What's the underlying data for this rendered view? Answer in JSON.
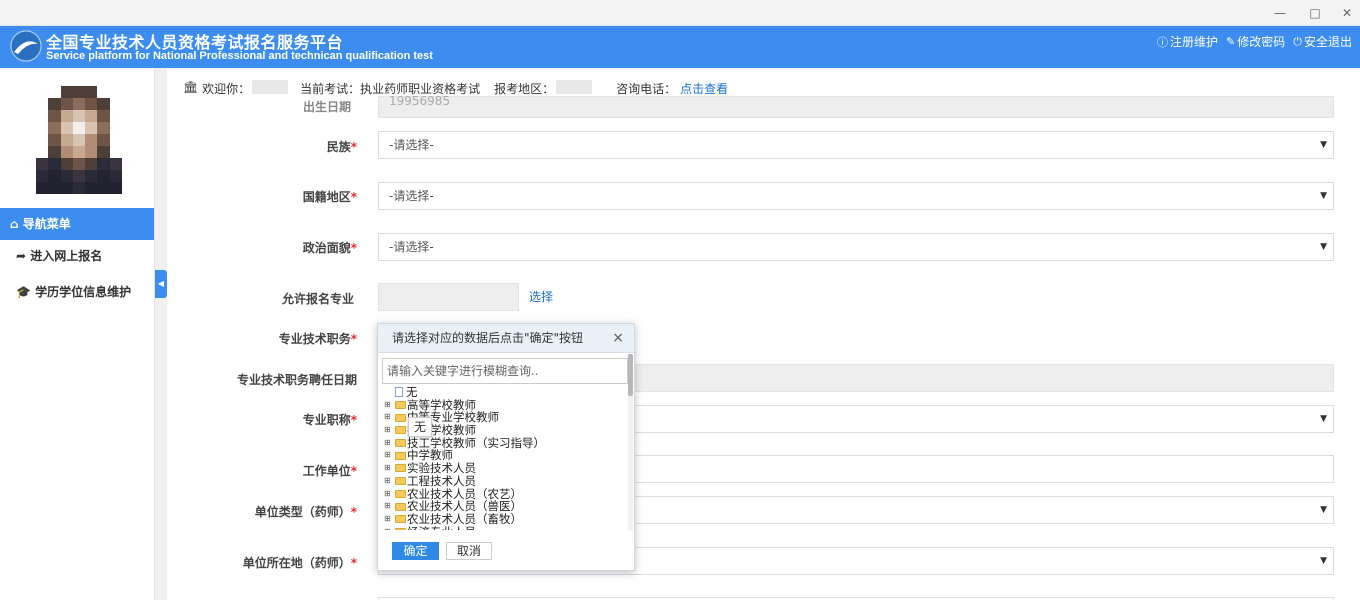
{
  "window": {
    "minimize": "—",
    "maximize": "□",
    "close": "✕"
  },
  "header": {
    "title_cn": "全国专业技术人员资格考试报名服务平台",
    "title_en": "Service platform for National Professional and technican qualification test",
    "actions": {
      "register_maintain": "注册维护",
      "change_password": "修改密码",
      "logout": "安全退出"
    }
  },
  "sidebar": {
    "nav_title": "导航菜单",
    "items": [
      {
        "label": "进入网上报名"
      },
      {
        "label": "学历学位信息维护"
      }
    ]
  },
  "info_bar": {
    "welcome": "欢迎你：",
    "current_exam_label": "当前考试：",
    "current_exam": "执业药师职业资格考试",
    "region_label": "报考地区：",
    "phone_label": "咨询电话：",
    "phone_link": "点击查看"
  },
  "form": {
    "partial_top_label": "出生日期",
    "partial_top_value": "19956985",
    "ethnicity": {
      "label": "民族",
      "value": "-请选择-"
    },
    "nationality": {
      "label": "国籍地区",
      "value": "-请选择-"
    },
    "political": {
      "label": "政治面貌",
      "value": "-请选择-"
    },
    "allowed_major": {
      "label": "允许报名专业",
      "link": "选择"
    },
    "tech_position": {
      "label": "专业技术职务"
    },
    "tech_position_date": {
      "label": "专业技术职务聘任日期"
    },
    "tech_title": {
      "label": "专业职称"
    },
    "work_unit": {
      "label": "工作单位"
    },
    "unit_type": {
      "label": "单位类型（药师）"
    },
    "unit_location": {
      "label": "单位所在地（药师）"
    },
    "required_mark": "*"
  },
  "modal": {
    "title": "请选择对应的数据后点击\"确定\"按钮",
    "close": "×",
    "search_placeholder": "请输入关键字进行模糊查询..",
    "tree": [
      {
        "label": "无",
        "type": "file"
      },
      {
        "label": "高等学校教师",
        "type": "folder"
      },
      {
        "label": "中等专业学校教师",
        "type": "folder"
      },
      {
        "label": "技工学校教师",
        "type": "folder"
      },
      {
        "label": "技工学校教师（实习指导）",
        "type": "folder"
      },
      {
        "label": "中学教师",
        "type": "folder"
      },
      {
        "label": "实验技术人员",
        "type": "folder"
      },
      {
        "label": "工程技术人员",
        "type": "folder"
      },
      {
        "label": "农业技术人员（农艺）",
        "type": "folder"
      },
      {
        "label": "农业技术人员（兽医）",
        "type": "folder"
      },
      {
        "label": "农业技术人员（畜牧）",
        "type": "folder"
      },
      {
        "label": "经济专业人员",
        "type": "folder"
      }
    ],
    "tooltip": "无",
    "ok": "确定",
    "cancel": "取消"
  },
  "colors": {
    "brand": "#3c8def",
    "link": "#1a6fd6",
    "required": "#d9302c"
  }
}
